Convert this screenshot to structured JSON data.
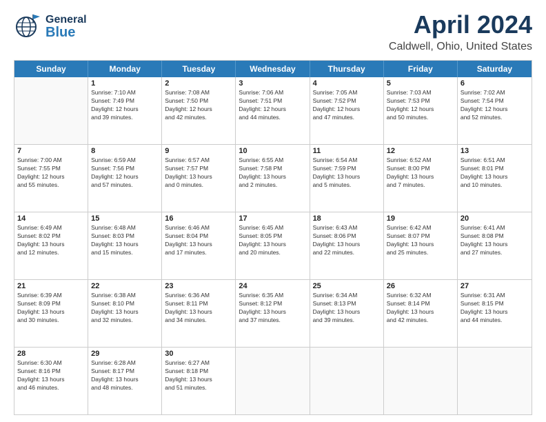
{
  "header": {
    "logo_general": "General",
    "logo_blue": "Blue",
    "title": "April 2024",
    "subtitle": "Caldwell, Ohio, United States"
  },
  "calendar": {
    "days": [
      "Sunday",
      "Monday",
      "Tuesday",
      "Wednesday",
      "Thursday",
      "Friday",
      "Saturday"
    ],
    "weeks": [
      [
        {
          "day": "",
          "content": ""
        },
        {
          "day": "1",
          "content": "Sunrise: 7:10 AM\nSunset: 7:49 PM\nDaylight: 12 hours\nand 39 minutes."
        },
        {
          "day": "2",
          "content": "Sunrise: 7:08 AM\nSunset: 7:50 PM\nDaylight: 12 hours\nand 42 minutes."
        },
        {
          "day": "3",
          "content": "Sunrise: 7:06 AM\nSunset: 7:51 PM\nDaylight: 12 hours\nand 44 minutes."
        },
        {
          "day": "4",
          "content": "Sunrise: 7:05 AM\nSunset: 7:52 PM\nDaylight: 12 hours\nand 47 minutes."
        },
        {
          "day": "5",
          "content": "Sunrise: 7:03 AM\nSunset: 7:53 PM\nDaylight: 12 hours\nand 50 minutes."
        },
        {
          "day": "6",
          "content": "Sunrise: 7:02 AM\nSunset: 7:54 PM\nDaylight: 12 hours\nand 52 minutes."
        }
      ],
      [
        {
          "day": "7",
          "content": "Sunrise: 7:00 AM\nSunset: 7:55 PM\nDaylight: 12 hours\nand 55 minutes."
        },
        {
          "day": "8",
          "content": "Sunrise: 6:59 AM\nSunset: 7:56 PM\nDaylight: 12 hours\nand 57 minutes."
        },
        {
          "day": "9",
          "content": "Sunrise: 6:57 AM\nSunset: 7:57 PM\nDaylight: 13 hours\nand 0 minutes."
        },
        {
          "day": "10",
          "content": "Sunrise: 6:55 AM\nSunset: 7:58 PM\nDaylight: 13 hours\nand 2 minutes."
        },
        {
          "day": "11",
          "content": "Sunrise: 6:54 AM\nSunset: 7:59 PM\nDaylight: 13 hours\nand 5 minutes."
        },
        {
          "day": "12",
          "content": "Sunrise: 6:52 AM\nSunset: 8:00 PM\nDaylight: 13 hours\nand 7 minutes."
        },
        {
          "day": "13",
          "content": "Sunrise: 6:51 AM\nSunset: 8:01 PM\nDaylight: 13 hours\nand 10 minutes."
        }
      ],
      [
        {
          "day": "14",
          "content": "Sunrise: 6:49 AM\nSunset: 8:02 PM\nDaylight: 13 hours\nand 12 minutes."
        },
        {
          "day": "15",
          "content": "Sunrise: 6:48 AM\nSunset: 8:03 PM\nDaylight: 13 hours\nand 15 minutes."
        },
        {
          "day": "16",
          "content": "Sunrise: 6:46 AM\nSunset: 8:04 PM\nDaylight: 13 hours\nand 17 minutes."
        },
        {
          "day": "17",
          "content": "Sunrise: 6:45 AM\nSunset: 8:05 PM\nDaylight: 13 hours\nand 20 minutes."
        },
        {
          "day": "18",
          "content": "Sunrise: 6:43 AM\nSunset: 8:06 PM\nDaylight: 13 hours\nand 22 minutes."
        },
        {
          "day": "19",
          "content": "Sunrise: 6:42 AM\nSunset: 8:07 PM\nDaylight: 13 hours\nand 25 minutes."
        },
        {
          "day": "20",
          "content": "Sunrise: 6:41 AM\nSunset: 8:08 PM\nDaylight: 13 hours\nand 27 minutes."
        }
      ],
      [
        {
          "day": "21",
          "content": "Sunrise: 6:39 AM\nSunset: 8:09 PM\nDaylight: 13 hours\nand 30 minutes."
        },
        {
          "day": "22",
          "content": "Sunrise: 6:38 AM\nSunset: 8:10 PM\nDaylight: 13 hours\nand 32 minutes."
        },
        {
          "day": "23",
          "content": "Sunrise: 6:36 AM\nSunset: 8:11 PM\nDaylight: 13 hours\nand 34 minutes."
        },
        {
          "day": "24",
          "content": "Sunrise: 6:35 AM\nSunset: 8:12 PM\nDaylight: 13 hours\nand 37 minutes."
        },
        {
          "day": "25",
          "content": "Sunrise: 6:34 AM\nSunset: 8:13 PM\nDaylight: 13 hours\nand 39 minutes."
        },
        {
          "day": "26",
          "content": "Sunrise: 6:32 AM\nSunset: 8:14 PM\nDaylight: 13 hours\nand 42 minutes."
        },
        {
          "day": "27",
          "content": "Sunrise: 6:31 AM\nSunset: 8:15 PM\nDaylight: 13 hours\nand 44 minutes."
        }
      ],
      [
        {
          "day": "28",
          "content": "Sunrise: 6:30 AM\nSunset: 8:16 PM\nDaylight: 13 hours\nand 46 minutes."
        },
        {
          "day": "29",
          "content": "Sunrise: 6:28 AM\nSunset: 8:17 PM\nDaylight: 13 hours\nand 48 minutes."
        },
        {
          "day": "30",
          "content": "Sunrise: 6:27 AM\nSunset: 8:18 PM\nDaylight: 13 hours\nand 51 minutes."
        },
        {
          "day": "",
          "content": ""
        },
        {
          "day": "",
          "content": ""
        },
        {
          "day": "",
          "content": ""
        },
        {
          "day": "",
          "content": ""
        }
      ]
    ]
  }
}
